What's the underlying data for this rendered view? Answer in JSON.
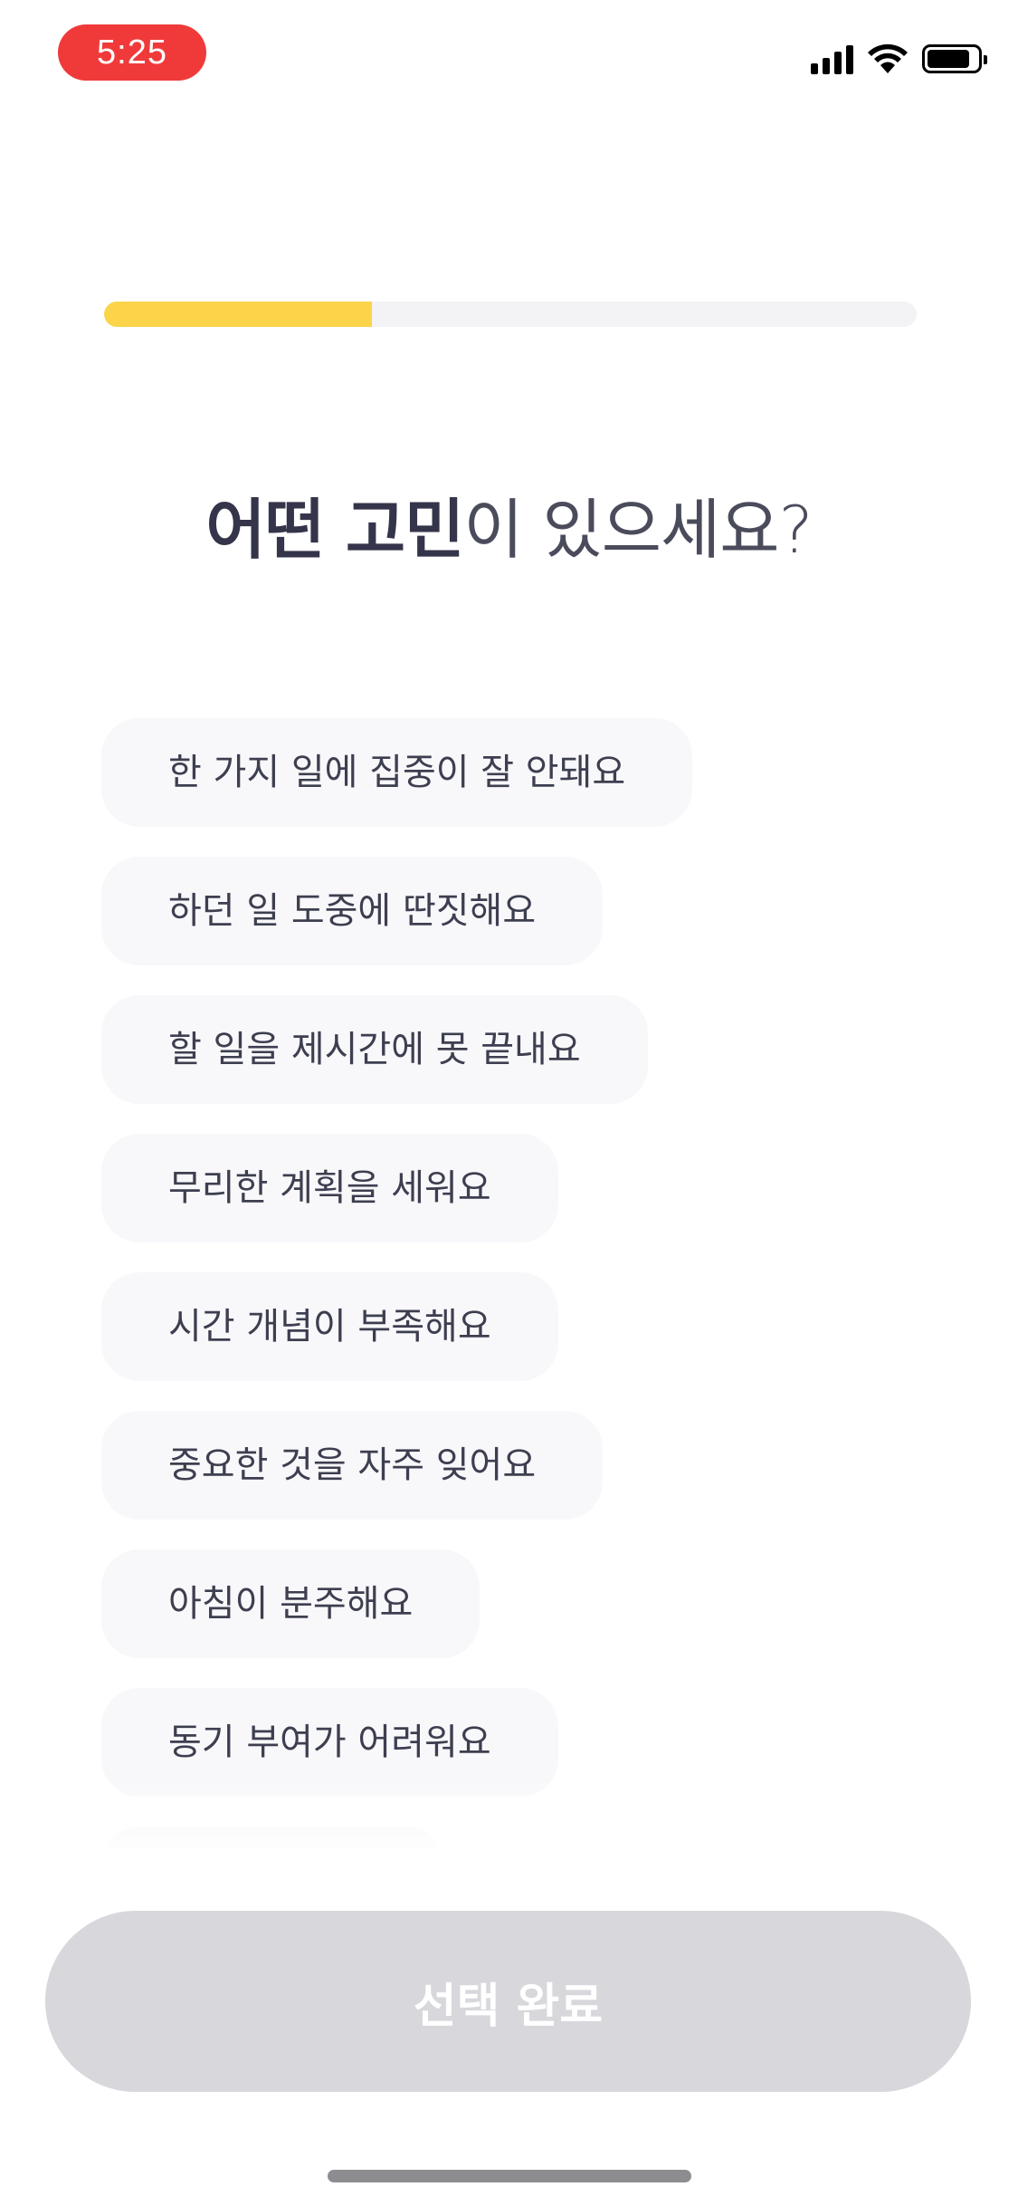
{
  "status_bar": {
    "time": "5:25",
    "icons": [
      "cellular-signal-icon",
      "wifi-icon",
      "battery-icon"
    ]
  },
  "progress": {
    "fraction": 0.33,
    "color": "#fbd44a"
  },
  "question": {
    "bold": "어떤 고민",
    "rest": "이 있으세요?"
  },
  "options": [
    {
      "label": "한 가지 일에 집중이 잘 안돼요"
    },
    {
      "label": "하던 일 도중에 딴짓해요"
    },
    {
      "label": "할 일을 제시간에 못 끝내요"
    },
    {
      "label": "무리한 계획을 세워요"
    },
    {
      "label": "시간 개념이 부족해요"
    },
    {
      "label": "중요한 것을 자주 잊어요"
    },
    {
      "label": "아침이 분주해요"
    },
    {
      "label": "동기 부여가 어려워요"
    },
    {
      "label": ""
    }
  ],
  "complete_button": {
    "label": "선택 완료",
    "enabled": false
  }
}
